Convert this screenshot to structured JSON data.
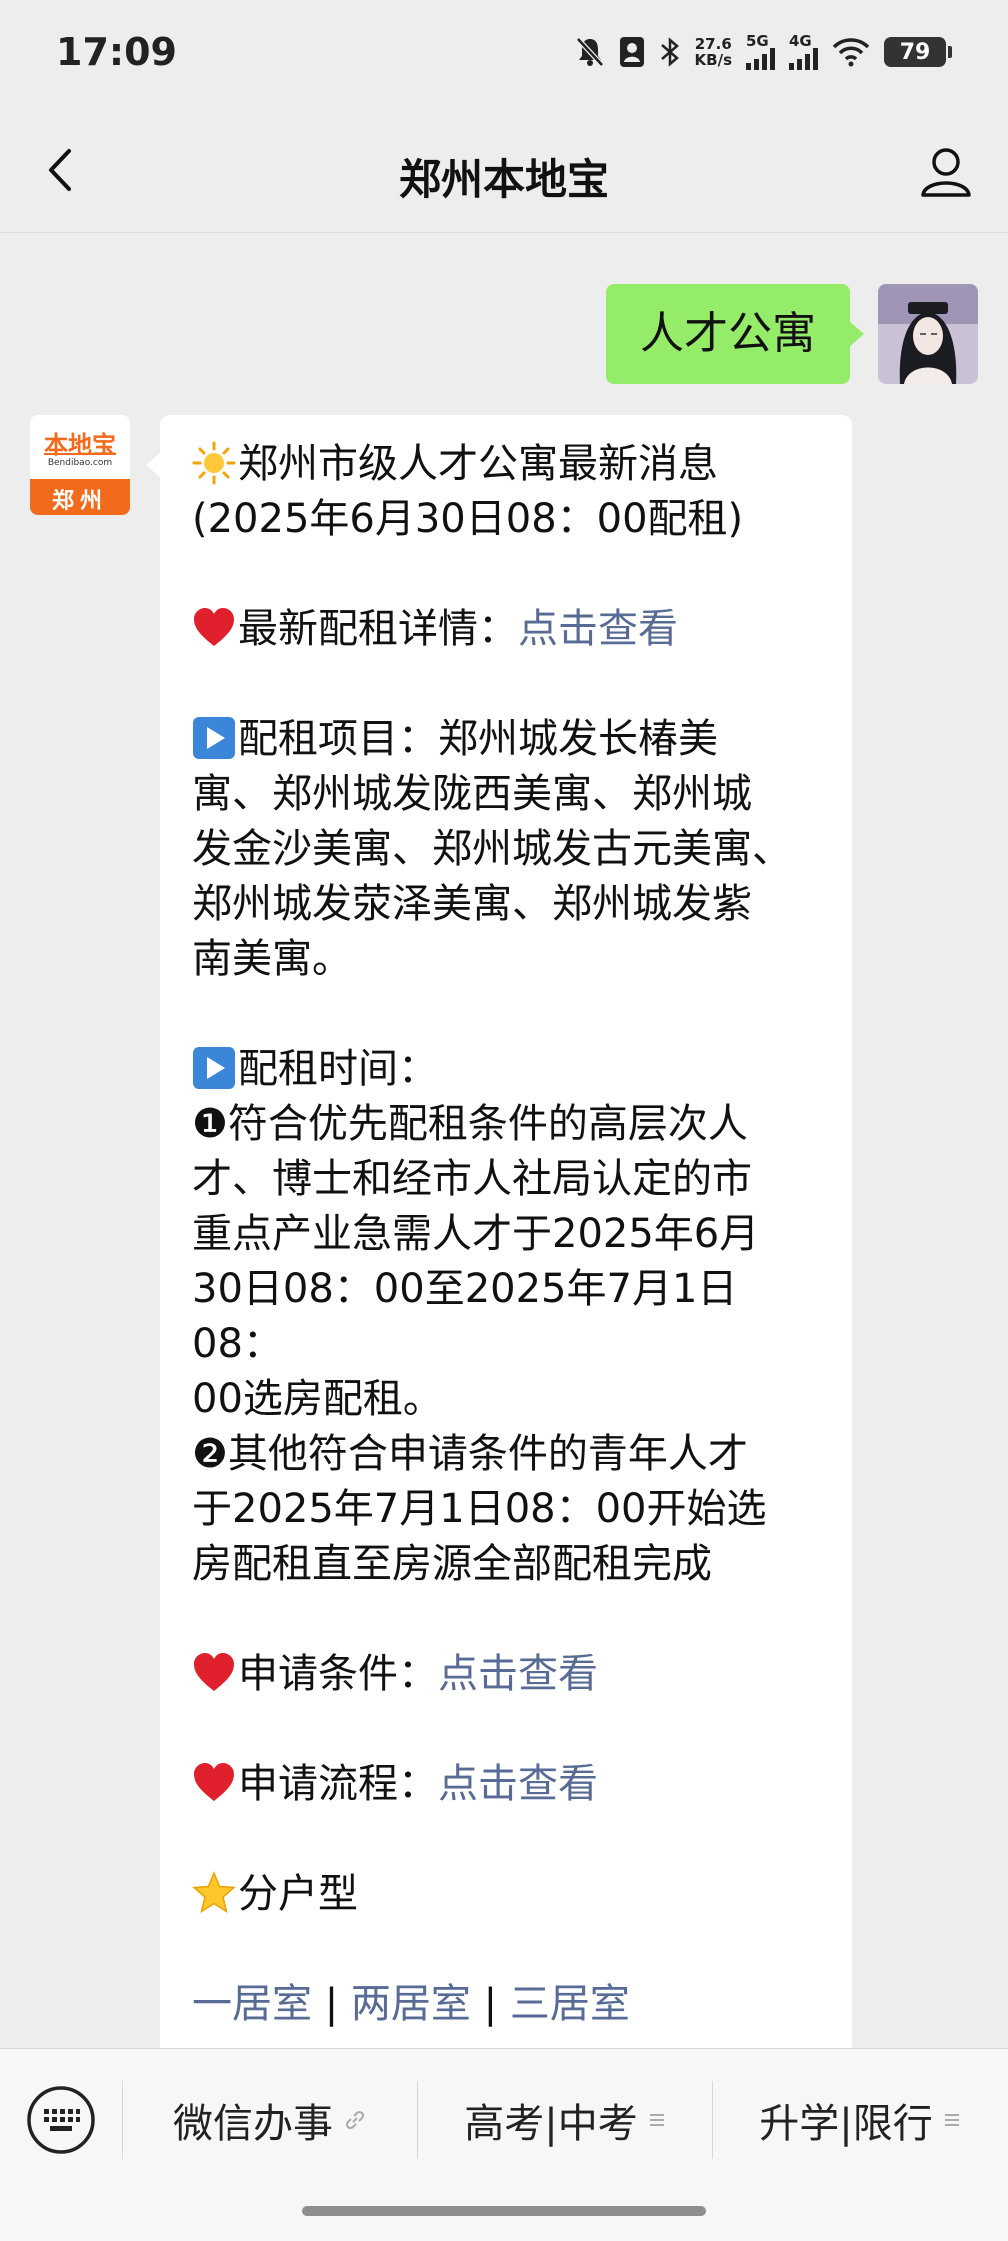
{
  "status_bar": {
    "time": "17:09",
    "net_speed_value": "27.6",
    "net_speed_unit": "KB/s",
    "signal1": "5G",
    "signal2": "4G",
    "battery": "79",
    "icons": [
      "mute-bell-icon",
      "portrait-icon",
      "bluetooth-icon",
      "signal-icon",
      "wifi-icon",
      "battery-icon"
    ]
  },
  "nav": {
    "title": "郑州本地宝",
    "back_icon": "chevron-left-icon",
    "profile_icon": "person-icon"
  },
  "outgoing": {
    "text": "人才公寓"
  },
  "sender_logo": {
    "top_text": "本地宝",
    "url_text": "Bendibao.com",
    "city_text": "郑州"
  },
  "message": {
    "headline_emoji": "sun-icon",
    "headline_1": "郑州市级人才公寓最新消息",
    "headline_2": "(2025年6月30日08：00配租)",
    "detail_label": "最新配租详情：",
    "detail_link": "点击查看",
    "projects_line_1": "配租项目：郑州城发长椿美",
    "projects_line_2": "寓、郑州城发陇西美寓、郑州城",
    "projects_line_3": "发金沙美寓、郑州城发古元美寓、",
    "projects_line_4": "郑州城发荥泽美寓、郑州城发紫",
    "projects_line_5": "南美寓。",
    "time_label": "配租时间：",
    "time1_line_1": "❶符合优先配租条件的高层次人",
    "time1_line_2": "才、博士和经市人社局认定的市",
    "time1_line_3": "重点产业急需人才于2025年6月",
    "time1_line_4": "30日08：00至2025年7月1日08：",
    "time1_line_5": "00选房配租。",
    "time2_line_1": "❷其他符合申请条件的青年人才",
    "time2_line_2": "于2025年7月1日08：00开始选",
    "time2_line_3": "房配租直至房源全部配租完成",
    "conditions_label": "申请条件：",
    "conditions_link": "点击查看",
    "process_label": "申请流程：",
    "process_link": "点击查看",
    "layout_label": "分户型",
    "layout_links": [
      "一居室",
      "两居室",
      "三居室"
    ],
    "separator": "|"
  },
  "bottom_menu": {
    "keyboard_icon": "keyboard-icon",
    "items": [
      {
        "label": "微信办事",
        "icon": "link-icon"
      },
      {
        "label": "高考|中考",
        "icon": "menu-lines-icon"
      },
      {
        "label": "升学|限行",
        "icon": "menu-lines-icon"
      }
    ]
  },
  "colors": {
    "link": "#576b95",
    "outgoing_bubble": "#95ec69",
    "background": "#ededed",
    "logo_orange": "#f26a1b"
  }
}
